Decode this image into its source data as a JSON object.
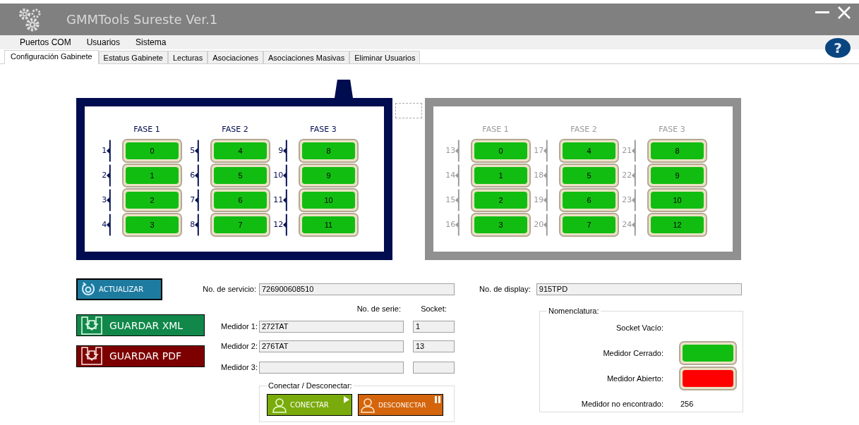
{
  "window": {
    "title": "GMMTools Sureste Ver.1"
  },
  "menu": [
    "Puertos COM",
    "Usuarios",
    "Sistema"
  ],
  "help_button": "?",
  "tabs": [
    {
      "label": "Configuración Gabinete",
      "selected": true
    },
    {
      "label": "Estatus Gabinete",
      "selected": false
    },
    {
      "label": "Lecturas",
      "selected": false
    },
    {
      "label": "Asociaciones",
      "selected": false
    },
    {
      "label": "Asociaciones Masivas",
      "selected": false
    },
    {
      "label": "Eliminar Usuarios",
      "selected": false
    }
  ],
  "cabinets": [
    {
      "selected": true,
      "phases": [
        {
          "title": "FASE 1",
          "sockets": [
            {
              "label": "1",
              "meter": "0",
              "color": "#12bd12"
            },
            {
              "label": "2",
              "meter": "1",
              "color": "#12bd12"
            },
            {
              "label": "3",
              "meter": "2",
              "color": "#12bd12"
            },
            {
              "label": "4",
              "meter": "3",
              "color": "#12bd12"
            }
          ]
        },
        {
          "title": "FASE 2",
          "sockets": [
            {
              "label": "5",
              "meter": "4",
              "color": "#12bd12"
            },
            {
              "label": "6",
              "meter": "5",
              "color": "#12bd12"
            },
            {
              "label": "7",
              "meter": "6",
              "color": "#12bd12"
            },
            {
              "label": "8",
              "meter": "7",
              "color": "#12bd12"
            }
          ]
        },
        {
          "title": "FASE 3",
          "sockets": [
            {
              "label": "9",
              "meter": "8",
              "color": "#12bd12"
            },
            {
              "label": "10",
              "meter": "9",
              "color": "#12bd12"
            },
            {
              "label": "11",
              "meter": "10",
              "color": "#12bd12"
            },
            {
              "label": "12",
              "meter": "11",
              "color": "#12bd12"
            }
          ]
        }
      ]
    },
    {
      "selected": false,
      "phases": [
        {
          "title": "FASE 1",
          "sockets": [
            {
              "label": "13",
              "meter": "0",
              "color": "#12bd12"
            },
            {
              "label": "14",
              "meter": "1",
              "color": "#12bd12"
            },
            {
              "label": "15",
              "meter": "2",
              "color": "#12bd12"
            },
            {
              "label": "16",
              "meter": "3",
              "color": "#12bd12"
            }
          ]
        },
        {
          "title": "FASE 2",
          "sockets": [
            {
              "label": "17",
              "meter": "4",
              "color": "#12bd12"
            },
            {
              "label": "18",
              "meter": "5",
              "color": "#12bd12"
            },
            {
              "label": "19",
              "meter": "6",
              "color": "#12bd12"
            },
            {
              "label": "20",
              "meter": "7",
              "color": "#12bd12"
            }
          ]
        },
        {
          "title": "FASE 3",
          "sockets": [
            {
              "label": "21",
              "meter": "8",
              "color": "#12bd12"
            },
            {
              "label": "22",
              "meter": "9",
              "color": "#12bd12"
            },
            {
              "label": "23",
              "meter": "10",
              "color": "#12bd12"
            },
            {
              "label": "24",
              "meter": "12",
              "color": "#12bd12"
            }
          ]
        }
      ]
    }
  ],
  "buttons": {
    "refresh": "ACTUALIZAR",
    "save_xml": "GUARDAR XML",
    "save_pdf": "GUARDAR PDF"
  },
  "service": {
    "label": "No. de servicio:",
    "value": "726900608510"
  },
  "display": {
    "label": "No. de display:",
    "value": "915TPD"
  },
  "meters_header": {
    "serial": "No. de serie:",
    "socket": "Socket:"
  },
  "meters": [
    {
      "label": "Medidor 1:",
      "serial": "272TAT",
      "socket": "1"
    },
    {
      "label": "Medidor 2:",
      "serial": "276TAT",
      "socket": "13"
    },
    {
      "label": "Medidor 3:"
    }
  ],
  "connect_group": {
    "title": "Conectar / Desconectar:",
    "connect": "CONECTAR",
    "disconnect": "DESCONECTAR"
  },
  "legend": {
    "title": "Nomenclatura:",
    "items": [
      {
        "kind": "empty",
        "label": "Socket Vacío:"
      },
      {
        "kind": "meter",
        "label": "Medidor Cerrado:",
        "color": "#12bd12"
      },
      {
        "kind": "meter",
        "label": "Medidor Abierto:",
        "color": "#ff0000"
      },
      {
        "kind": "text",
        "label": "Medidor no encontrado:",
        "value": "256"
      }
    ]
  }
}
